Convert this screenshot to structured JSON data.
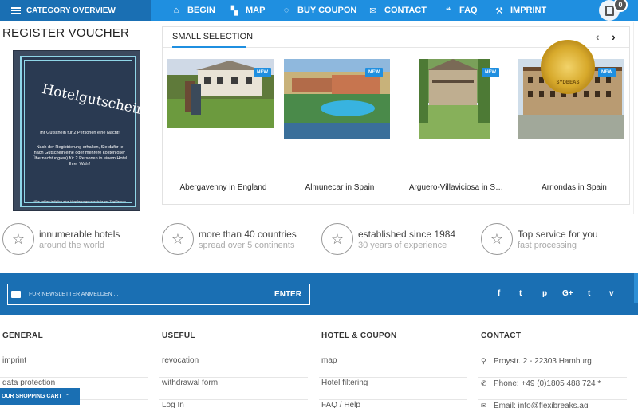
{
  "topbar": {
    "category_label": "CATEGORY OVERVIEW",
    "nav": [
      {
        "label": "BEGIN",
        "icon": "home-icon",
        "glyph": "⌂"
      },
      {
        "label": "MAP",
        "icon": "map-icon",
        "glyph": "▚"
      },
      {
        "label": "BUY COUPON",
        "icon": "coupon-icon",
        "glyph": "◌"
      },
      {
        "label": "CONTACT",
        "icon": "envelope-icon",
        "glyph": "✉"
      },
      {
        "label": "FAQ",
        "icon": "chat-icon",
        "glyph": "❝"
      },
      {
        "label": "IMPRINT",
        "icon": "gavel-icon",
        "glyph": "⚒"
      }
    ],
    "calculator_icon": "calculator-icon",
    "cart_count": "0"
  },
  "voucher": {
    "heading": "REGISTER VOUCHER",
    "image_title": "Hotelgutschein",
    "line1": "Ihr Gutschein für 2 Personen eine Nacht!",
    "line2": "Nach der Registrierung erhalten, Sie dafür je nach Gutschein eine oder mehrere kostenlose* Übernachtung(en) für 2 Personen in einem Hotel Ihrer Wahl!",
    "footnote": "*Sie zahlen lediglich eine Verpflegungspauschale pro Tag/Person"
  },
  "selection": {
    "title": "SMALL SELECTION",
    "prev_icon": "chevron-left-icon",
    "next_icon": "chevron-right-icon",
    "badge": "NEW",
    "items": [
      {
        "name": "Abergavenny in England"
      },
      {
        "name": "Almunecar in Spain"
      },
      {
        "name": "Arguero-Villaviciosa in S…"
      },
      {
        "name": "Arriondas in Spain"
      }
    ]
  },
  "features": [
    {
      "title": "innumerable hotels",
      "sub": "around the world",
      "icon": "star-icon"
    },
    {
      "title": "more than 40 countries",
      "sub": "spread over 5 continents",
      "icon": "star-icon"
    },
    {
      "title": "established since 1984",
      "sub": "30 years of experience",
      "icon": "star-icon"
    },
    {
      "title": "Top service for you",
      "sub": "fast processing",
      "icon": "star-icon"
    }
  ],
  "newsletter": {
    "placeholder": "FÜR NEWSLETTER ANMELDEN ...",
    "button": "ENTER"
  },
  "social": [
    {
      "glyph": "f",
      "icon": "facebook-icon"
    },
    {
      "glyph": "t",
      "icon": "twitter-icon"
    },
    {
      "glyph": "p",
      "icon": "pinterest-icon"
    },
    {
      "glyph": "G+",
      "icon": "google-plus-icon"
    },
    {
      "glyph": "t",
      "icon": "tumblr-icon"
    },
    {
      "glyph": "v",
      "icon": "vimeo-icon"
    }
  ],
  "footer": {
    "general": {
      "heading": "GENERAL",
      "links": [
        "imprint",
        "data protection"
      ]
    },
    "useful": {
      "heading": "USEFUL",
      "links": [
        "revocation",
        "withdrawal form",
        "Log In"
      ]
    },
    "hotel": {
      "heading": "HOTEL & COUPON",
      "links": [
        "map",
        "Hotel filtering",
        "FAQ / Help"
      ]
    },
    "contact": {
      "heading": "CONTACT",
      "address": "Proystr. 2 - 22303 Hamburg",
      "phone": "Phone: +49 (0)1805 488 724 *",
      "email": "Email: info@flexibreaks.ag"
    }
  },
  "cart": {
    "label": "OUR SHOPPING CART"
  },
  "colors": {
    "primary": "#1f8fe0",
    "dark": "#1a6fb3"
  }
}
